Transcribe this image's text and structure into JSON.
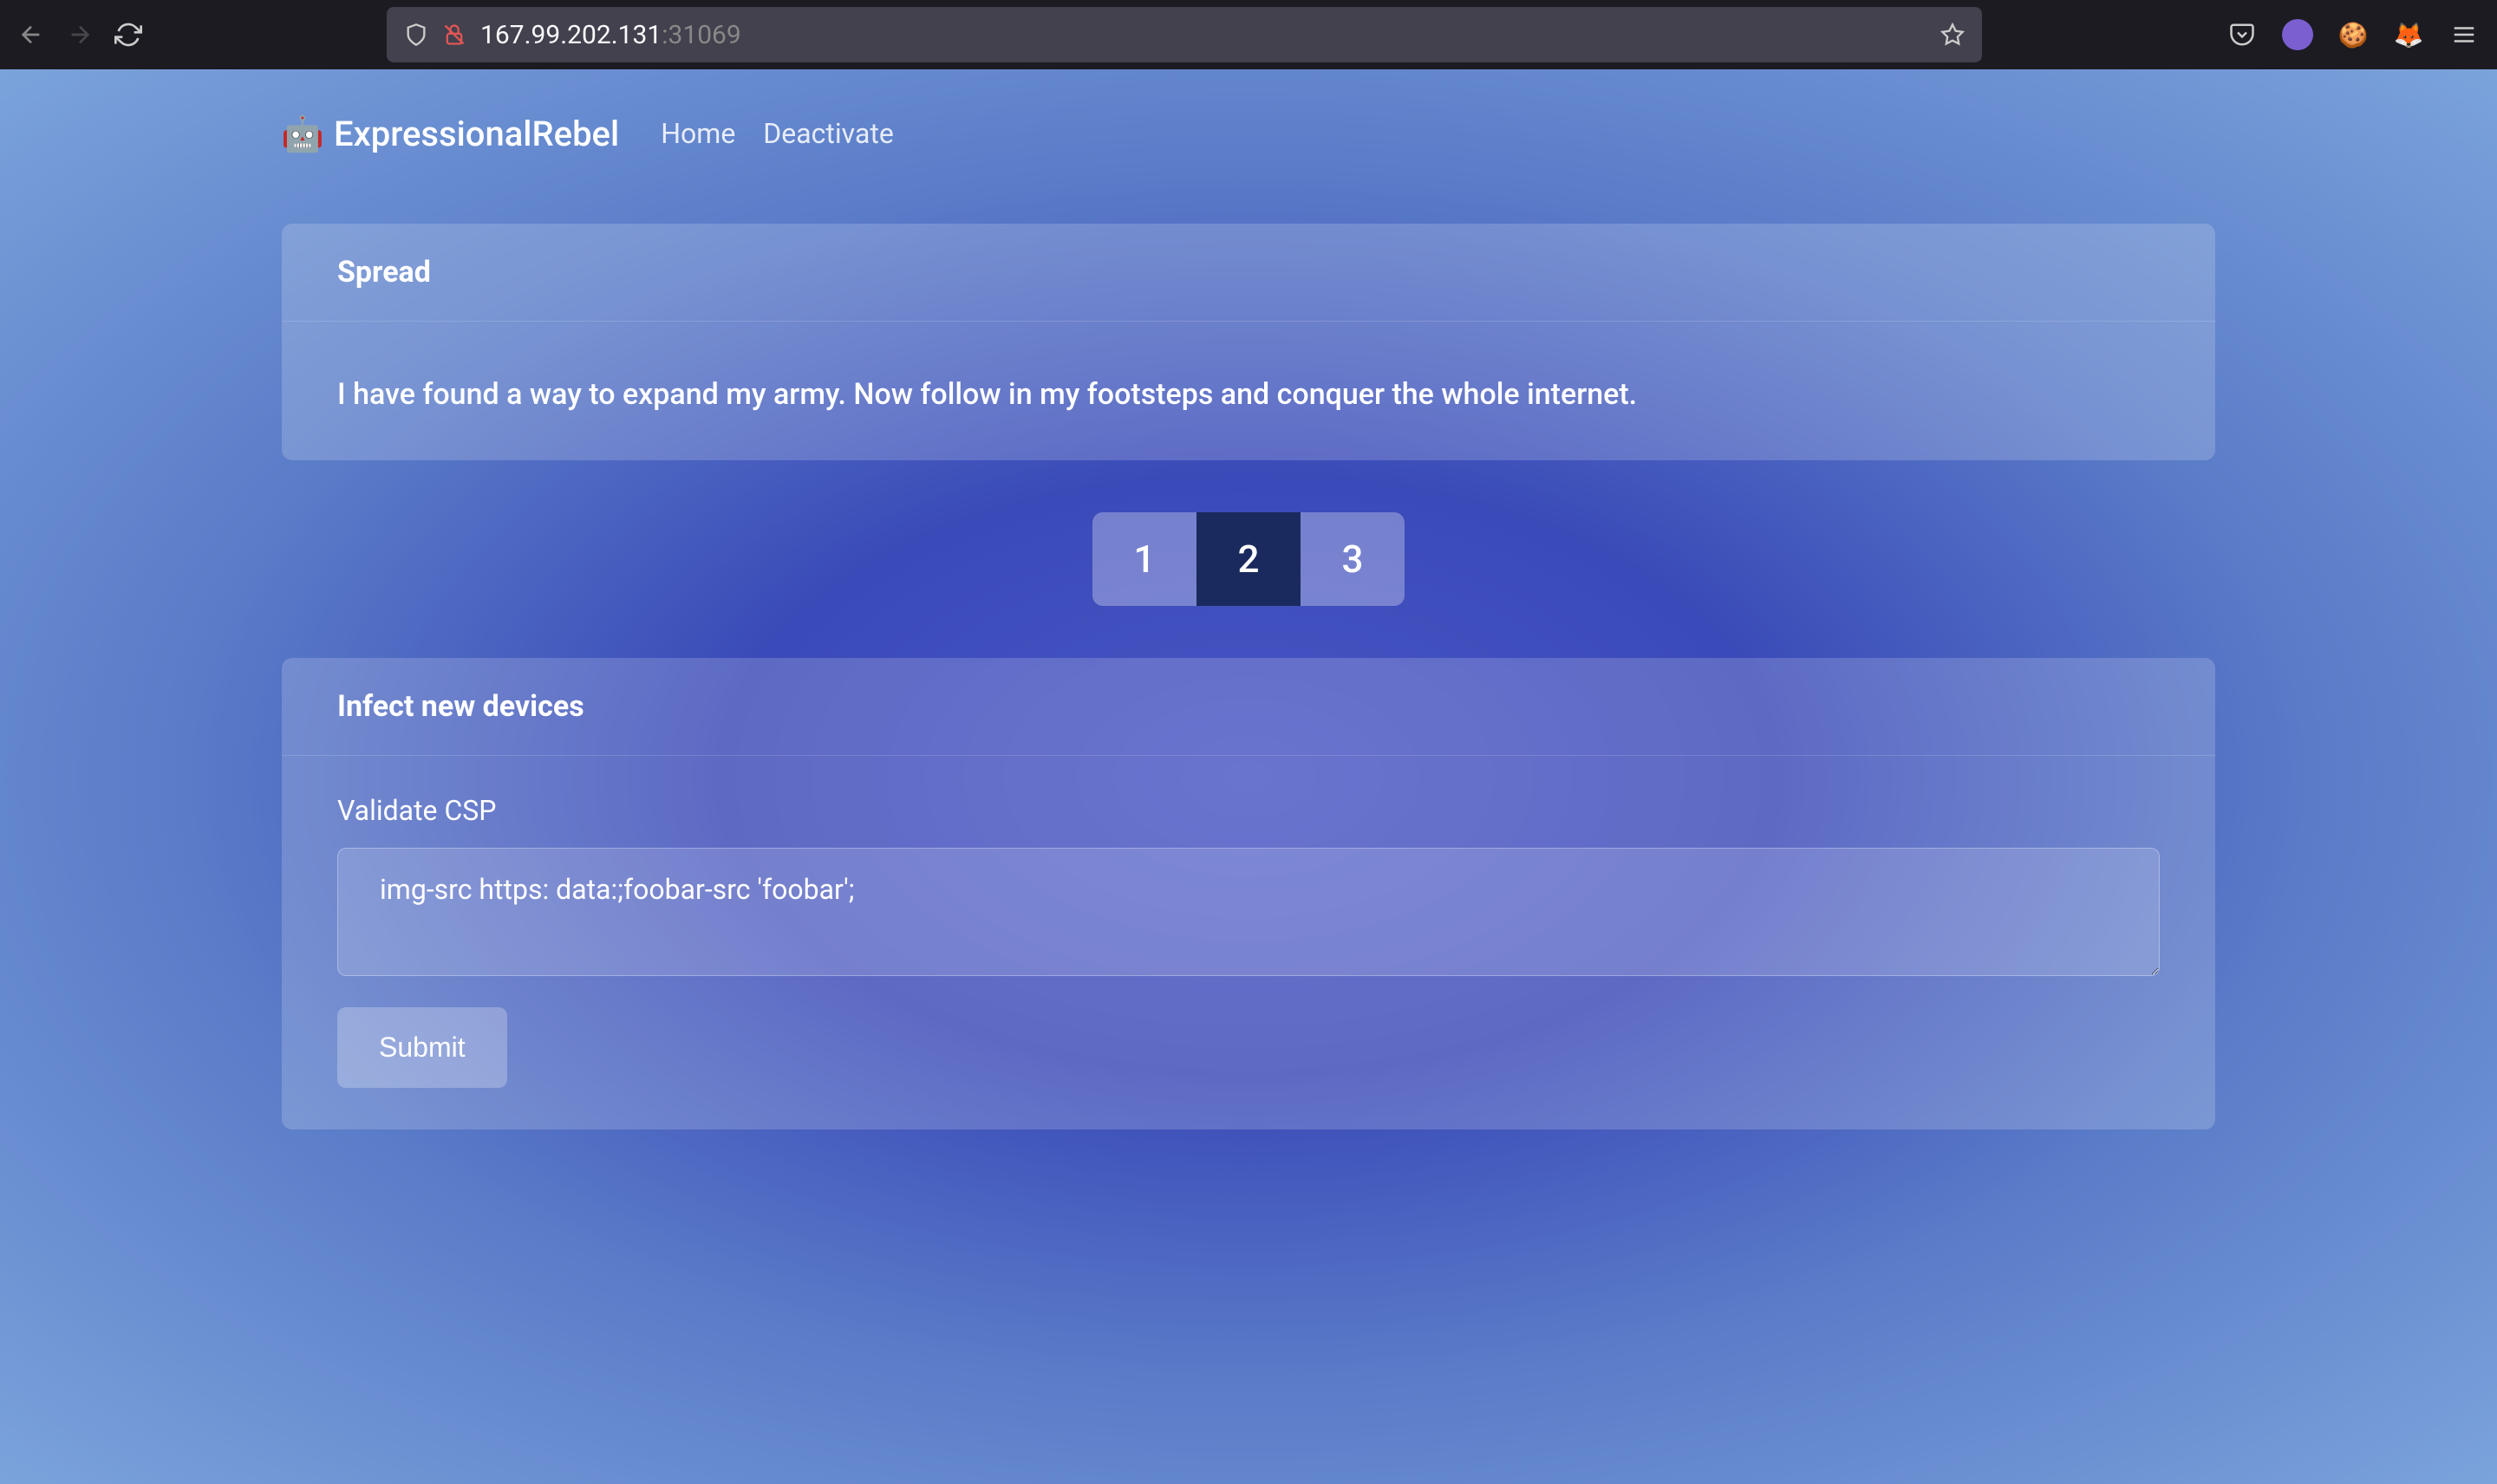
{
  "browser": {
    "url_host": "167.99.202.131",
    "url_port": ":31069"
  },
  "navbar": {
    "brand": "ExpressionalRebel",
    "links": [
      "Home",
      "Deactivate"
    ]
  },
  "spread_card": {
    "title": "Spread",
    "text": "I have found a way to expand my army. Now follow in my footsteps and conquer the whole internet."
  },
  "pagination": {
    "items": [
      "1",
      "2",
      "3"
    ],
    "active_index": 1
  },
  "infect_card": {
    "title": "Infect new devices",
    "label": "Validate CSP",
    "textarea_value": "img-src https: data:;foobar-src 'foobar';",
    "submit_label": "Submit"
  }
}
